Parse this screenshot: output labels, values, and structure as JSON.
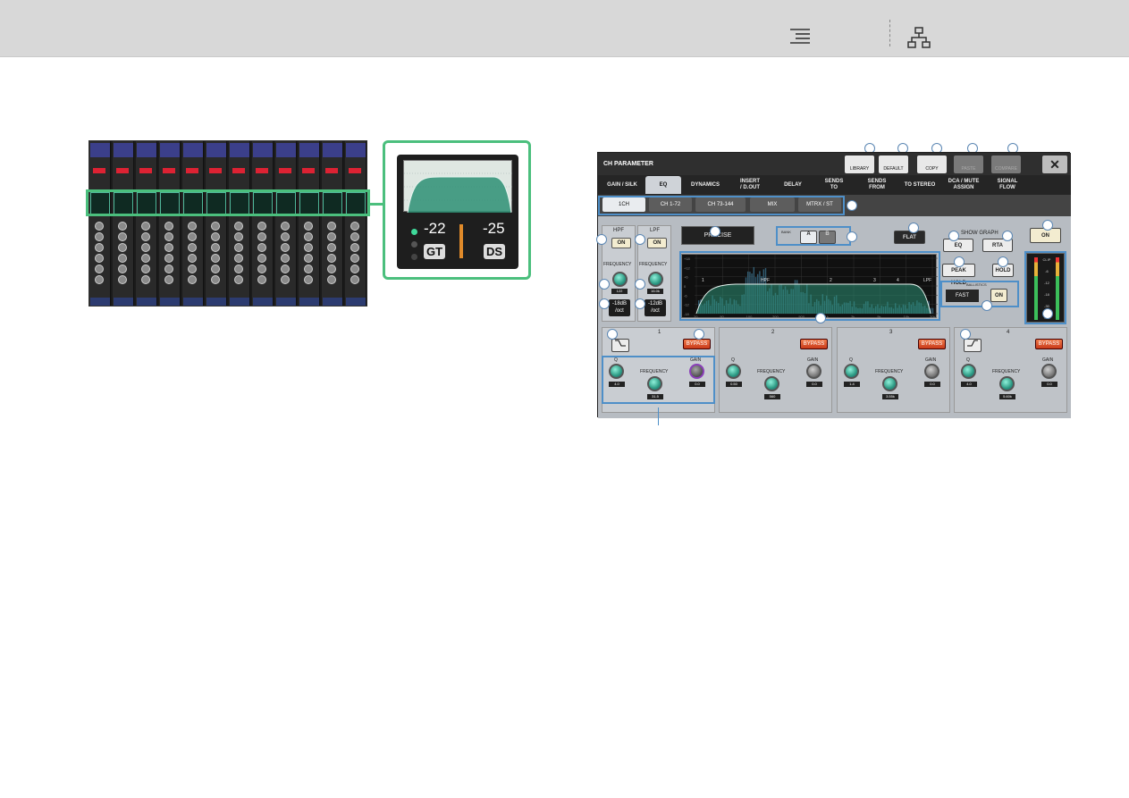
{
  "header": {
    "toc_icon": "list-indent-icon",
    "nav_icon": "sitemap-icon"
  },
  "zoom": {
    "gate_value": "-22",
    "ducker_value": "-25",
    "gate_btn": "GT",
    "dynamics_btn": "DS"
  },
  "panel": {
    "title": "CH PARAMETER",
    "toolbar": {
      "library": "LIBRARY",
      "default": "DEFAULT",
      "copy": "COPY",
      "paste": "PASTE",
      "compare": "COMPARE",
      "close": "✕"
    },
    "tabs": [
      "GAIN / SILK",
      "EQ",
      "DYNAMICS",
      "INSERT\n/ D.OUT",
      "DELAY",
      "SENDS\nTO",
      "SENDS\nFROM",
      "TO STEREO",
      "DCA / MUTE\nASSIGN",
      "SIGNAL\nFLOW"
    ],
    "channel_buttons": [
      "1CH",
      "CH 1-72",
      "CH 73-144",
      "MIX",
      "MTRX / ST"
    ],
    "hpf": {
      "label": "HPF",
      "on": "ON",
      "freq_label": "FREQUENCY",
      "freq": "122",
      "slope": "-18dB\n/oct"
    },
    "lpf": {
      "label": "LPF",
      "on": "ON",
      "freq_label": "FREQUENCY",
      "freq": "16.0k",
      "slope": "-12dB\n/oct"
    },
    "eq_type": "PRECISE",
    "bank": {
      "label": "BANK",
      "a": "A",
      "b": "B"
    },
    "flat": "FLAT",
    "show_graph": {
      "label": "SHOW GRAPH",
      "eq": "EQ",
      "rta": "RTA"
    },
    "peak_hold": "PEAK HOLD",
    "hold": "HOLD",
    "ballistics": {
      "label": "BALLISTICS",
      "mode": "FAST",
      "on": "ON"
    },
    "eq_on": "ON",
    "bands": [
      {
        "num": "1",
        "bypass": "BYPASS",
        "q": "4.0",
        "freq": "31.5",
        "gain": "0.0"
      },
      {
        "num": "2",
        "bypass": "BYPASS",
        "q": "0.50",
        "freq": "560",
        "gain": "0.0"
      },
      {
        "num": "3",
        "bypass": "BYPASS",
        "q": "1.4",
        "freq": "3.55k",
        "gain": "0.0"
      },
      {
        "num": "4",
        "bypass": "BYPASS",
        "q": "4.0",
        "freq": "5.60k",
        "gain": "0.0"
      }
    ],
    "knob_labels": {
      "q": "Q",
      "frequency": "FREQUENCY",
      "gain": "GAIN"
    },
    "graph_labels": [
      "1",
      "HPF",
      "2",
      "3",
      "4",
      "LPF"
    ],
    "graph_yticks": [
      "+18",
      "+12",
      "+6",
      "0",
      "-6",
      "-12",
      "-18"
    ],
    "graph_xticks": [
      "20",
      "50",
      "100",
      "200",
      "500",
      "1k",
      "2k",
      "5k",
      "10k",
      "20k"
    ],
    "meter_scale": [
      "CLIP",
      "-6",
      "-12",
      "-18",
      "-30",
      "-40"
    ]
  },
  "colors": {
    "highlight_green": "#4bbf7d",
    "callout_blue": "#4e8fc8",
    "bypass_red": "#e05a2a"
  }
}
